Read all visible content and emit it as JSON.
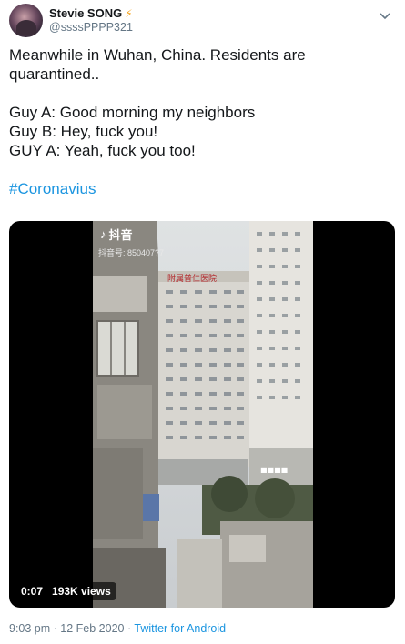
{
  "user": {
    "display_name": "Stevie SONG",
    "verified_icon": "lightning-icon",
    "handle": "@ssssPPPP321"
  },
  "tweet": {
    "lines_1": "Meanwhile in Wuhan, China. Residents are quarantined..",
    "line_a": "Guy A: Good morning my neighbors",
    "line_b": "Guy B: Hey, fuck you!",
    "line_c": "GUY A: Yeah, fuck you too!",
    "hashtag": "#Coronavius"
  },
  "media": {
    "duration": "0:07",
    "views": "193K views",
    "overlay_app": "抖音",
    "overlay_id": "抖音号: 850407?7",
    "building_sign": "附属普仁医院"
  },
  "footer": {
    "time": "9:03 pm",
    "separator_1": " · ",
    "date": "12 Feb 2020",
    "separator_2": " · ",
    "app": "Twitter for Android"
  },
  "colors": {
    "link": "#1b95e0",
    "secondary_text": "#657786"
  }
}
